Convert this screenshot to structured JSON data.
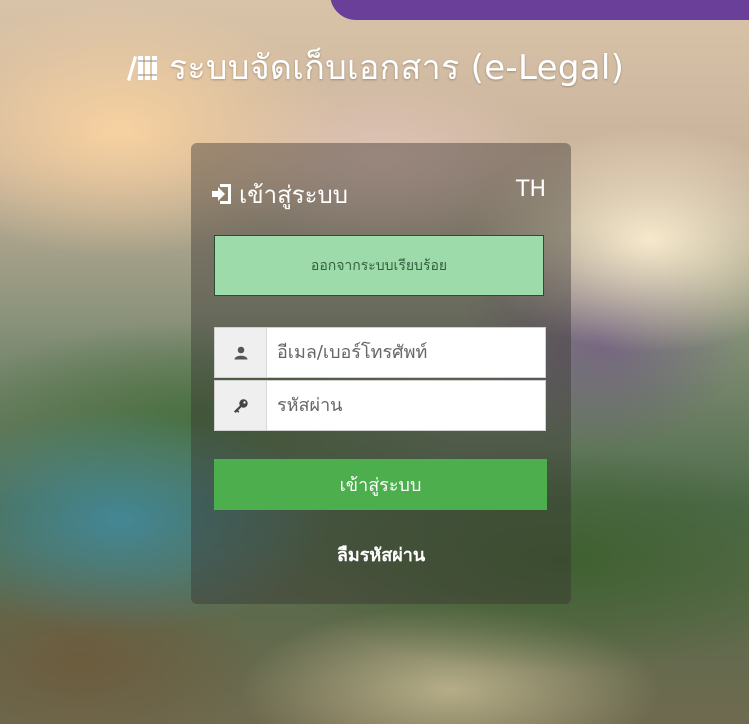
{
  "header": {
    "title": "ระบบจัดเก็บเอกสาร (e-Legal)",
    "icon": "books-icon"
  },
  "login_card": {
    "title": "เข้าสู่ระบบ",
    "title_icon": "sign-in-icon",
    "language": "TH",
    "alert_message": "ออกจากระบบเรียบร้อย",
    "username": {
      "placeholder": "อีเมล/เบอร์โทรศัพท์",
      "value": "",
      "icon": "user-icon"
    },
    "password": {
      "placeholder": "รหัสผ่าน",
      "value": "",
      "icon": "key-icon"
    },
    "login_button": "เข้าสู่ระบบ",
    "forgot_password": "ลืมรหัสผ่าน"
  },
  "colors": {
    "accent_purple": "#6a3f9a",
    "login_button": "#4cae4c",
    "alert_bg": "#9edbaa"
  }
}
